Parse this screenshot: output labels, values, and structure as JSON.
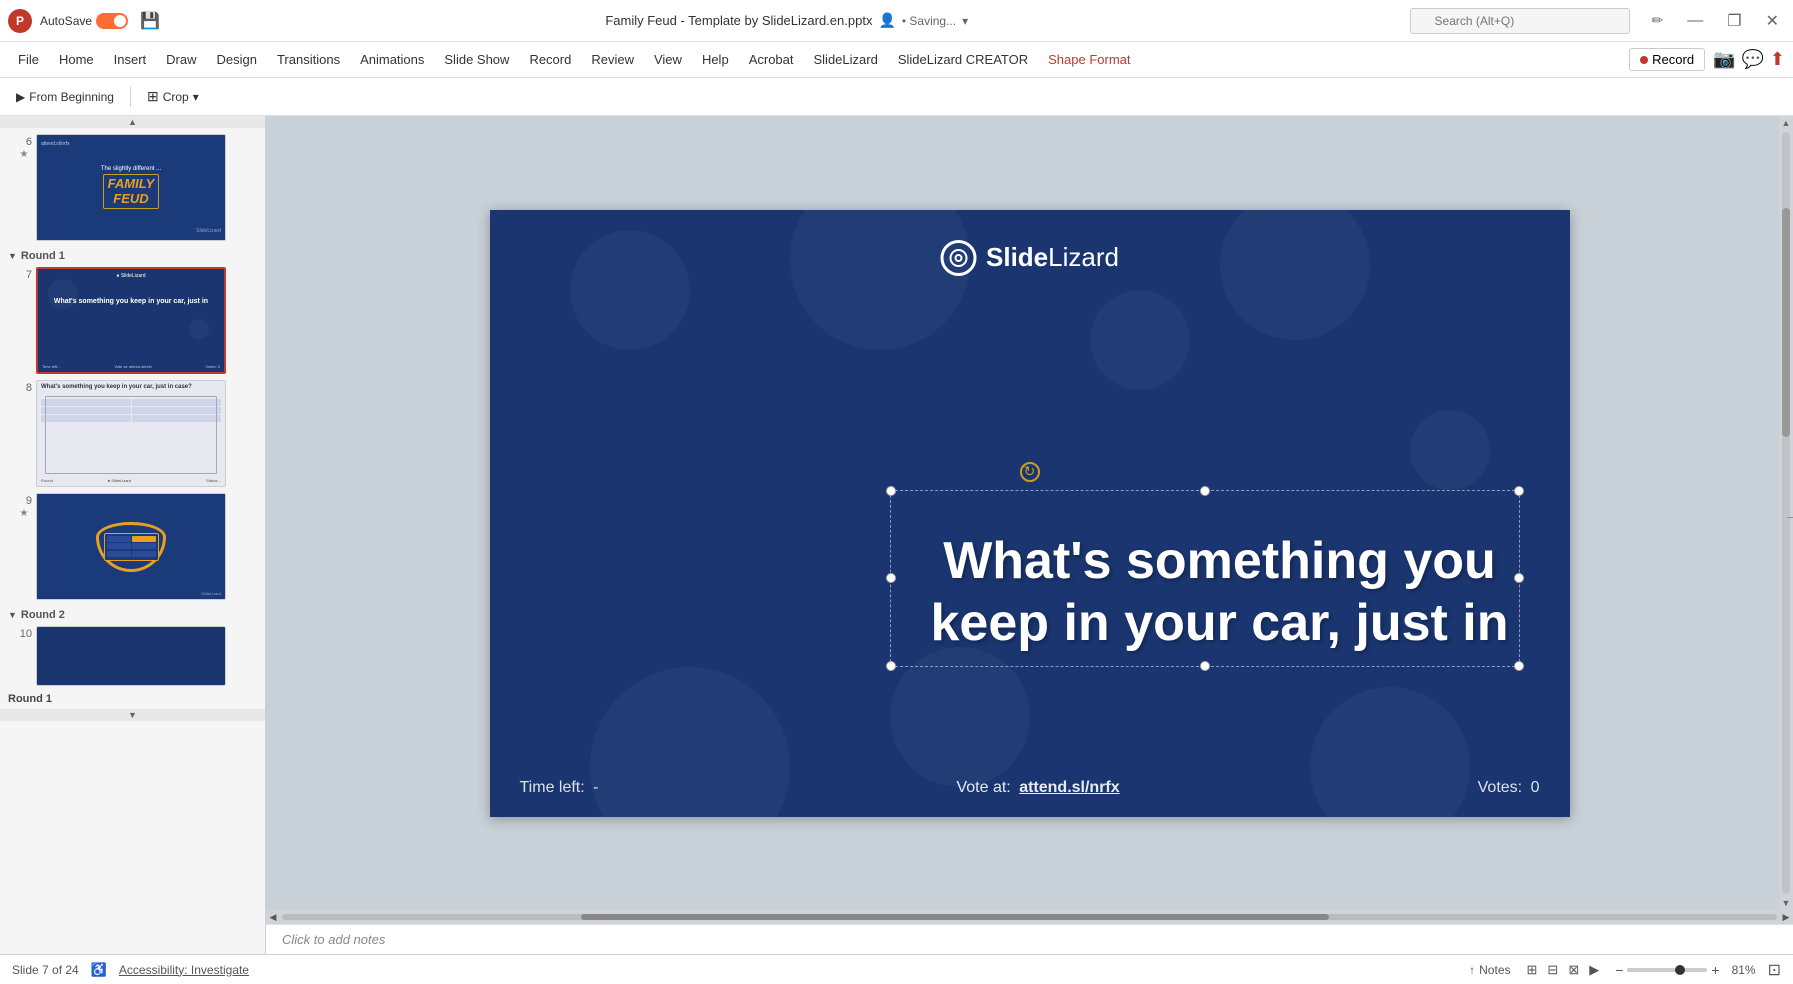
{
  "titlebar": {
    "logo": "P",
    "autosave_label": "AutoSave",
    "toggle_state": "on",
    "save_icon": "💾",
    "filename": "Family Feud - Template by SlideLizard.en.pptx",
    "collab_icon": "👤",
    "saving_label": "• Saving...",
    "search_placeholder": "Search (Alt+Q)",
    "minimize_label": "—",
    "restore_label": "❐",
    "close_label": "✕"
  },
  "menubar": {
    "items": [
      {
        "id": "file",
        "label": "File"
      },
      {
        "id": "home",
        "label": "Home"
      },
      {
        "id": "insert",
        "label": "Insert"
      },
      {
        "id": "draw",
        "label": "Draw"
      },
      {
        "id": "design",
        "label": "Design"
      },
      {
        "id": "transitions",
        "label": "Transitions"
      },
      {
        "id": "animations",
        "label": "Animations"
      },
      {
        "id": "slideshow",
        "label": "Slide Show"
      },
      {
        "id": "record",
        "label": "Record"
      },
      {
        "id": "review",
        "label": "Review"
      },
      {
        "id": "view",
        "label": "View"
      },
      {
        "id": "help",
        "label": "Help"
      },
      {
        "id": "acrobat",
        "label": "Acrobat"
      },
      {
        "id": "slidelizard",
        "label": "SlideLizard"
      },
      {
        "id": "slidelizard_creator",
        "label": "SlideLizard CREATOR"
      },
      {
        "id": "shape_format",
        "label": "Shape Format"
      }
    ],
    "record_btn_label": "Record"
  },
  "toolbar": {
    "from_beginning_label": "From Beginning",
    "crop_label": "Crop",
    "dropdown_label": "▾"
  },
  "slides": {
    "group1": {
      "label": "Round 1",
      "collapsed": false,
      "items": [
        {
          "number": "6",
          "star": "★",
          "type": "feud-title"
        },
        {
          "number": "7",
          "star": "",
          "type": "question",
          "active": true
        },
        {
          "number": "8",
          "star": "",
          "type": "answers"
        },
        {
          "number": "9",
          "star": "★",
          "type": "scoreboard"
        }
      ]
    },
    "group2": {
      "label": "Round 2",
      "collapsed": false,
      "items": [
        {
          "number": "10",
          "star": "",
          "type": "round2"
        }
      ]
    }
  },
  "canvas": {
    "logo_slide": "SlideLizard",
    "logo_bold": "Slide",
    "logo_light": "Lizard",
    "question_text": "What's something you keep in your car, just in",
    "footer": {
      "time_left_label": "Time left:",
      "time_left_value": "-",
      "vote_label": "Vote at:",
      "vote_url": "attend.sl/nrfx",
      "votes_label": "Votes:",
      "votes_value": "0"
    }
  },
  "statusbar": {
    "slide_info": "Slide 7 of 24",
    "accessibility_icon": "♿",
    "accessibility_label": "Accessibility: Investigate",
    "notes_label": "Notes",
    "zoom_level": "81%",
    "fit_btn": "⊡"
  },
  "notes": {
    "placeholder": "Click to add notes"
  }
}
